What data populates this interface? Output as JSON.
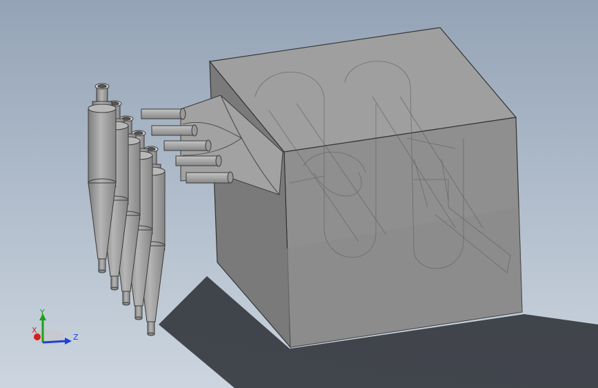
{
  "viewport": {
    "background_top": "#94a3b6",
    "background_bottom": "#ccd5df"
  },
  "triad": {
    "x_label": "X",
    "y_label": "Y",
    "z_label": "Z",
    "x_color": "#d42020",
    "y_color": "#1aa31a",
    "z_color": "#1f3fd6"
  },
  "model": {
    "cyclone_count": 5,
    "body_color": "#9a9a9a",
    "box_color": "#8c8c8c"
  }
}
